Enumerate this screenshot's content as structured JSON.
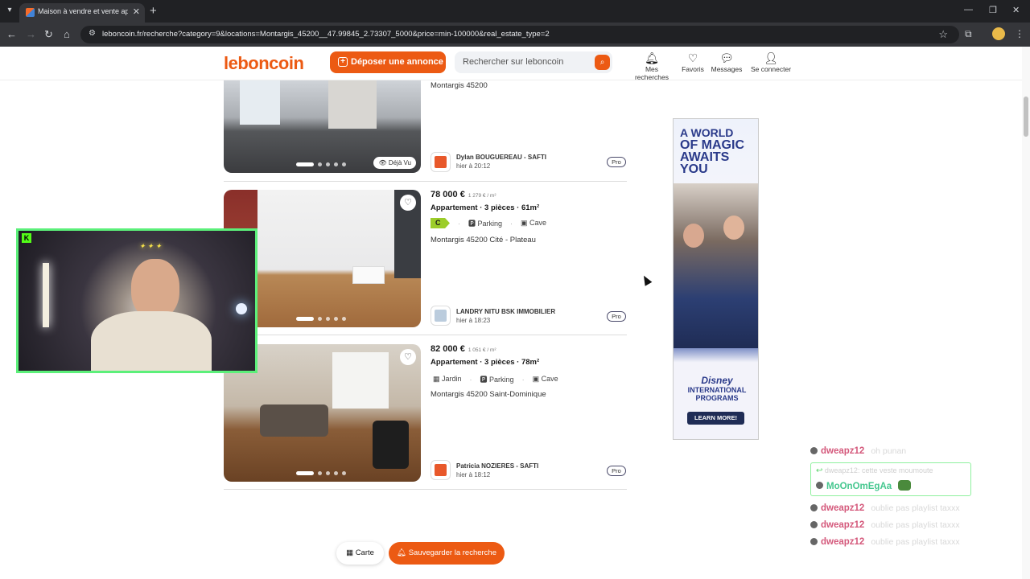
{
  "browser": {
    "tab_title": "Maison à vendre et vente appa",
    "url": "leboncoin.fr/recherche?category=9&locations=Montargis_45200__47.99845_2.73307_5000&price=min-100000&real_estate_type=2"
  },
  "header": {
    "logo": "leboncoin",
    "post_ad": "Déposer une annonce",
    "search_placeholder": "Rechercher sur leboncoin",
    "nav": [
      {
        "label": "Mes recherches",
        "icon": "bell-icon"
      },
      {
        "label": "Favoris",
        "icon": "heart-icon"
      },
      {
        "label": "Messages",
        "icon": "chat-icon"
      },
      {
        "label": "Se connecter",
        "icon": "user-icon"
      }
    ]
  },
  "listings": [
    {
      "location": "Montargis 45200",
      "seen_badge": "Déjà Vu",
      "seller": "Dylan BOUGUEREAU - SAFTI",
      "date": "hier à 20:12",
      "pro": "Pro"
    },
    {
      "price": "78 000 €",
      "price_per_m2": "1 279 € / m²",
      "title": "Appartement · 3 pièces · 61m²",
      "energy": "C",
      "tags": [
        "Parking",
        "Cave"
      ],
      "location": "Montargis 45200 Cité - Plateau",
      "seller": "LANDRY NITU BSK IMMOBILIER",
      "date": "hier à 18:23",
      "pro": "Pro"
    },
    {
      "price": "82 000 €",
      "price_per_m2": "1 051 € / m²",
      "title": "Appartement · 3 pièces · 78m²",
      "tags": [
        "Jardin",
        "Parking",
        "Cave"
      ],
      "location": "Montargis 45200 Saint-Dominique",
      "seller": "Patricia NOZIERES - SAFTI",
      "date": "hier à 18:12",
      "pro": "Pro"
    }
  ],
  "ad": {
    "line1": "A WORLD",
    "line2": "OF MAGIC",
    "line3": "AWAITS YOU",
    "brand": "Disney",
    "programs": "INTERNATIONAL PROGRAMS",
    "cta": "LEARN MORE!"
  },
  "chat": [
    {
      "user": "dweapz12",
      "msg": "oh punan"
    },
    {
      "reply_to": "dweapz12: cette veste moumoute",
      "user": "MoOnOmEgAa"
    },
    {
      "user": "dweapz12",
      "msg": "oublie pas playlist taxxx"
    },
    {
      "user": "dweapz12",
      "msg": "oublie pas playlist taxxx"
    },
    {
      "user": "dweapz12",
      "msg": "oublie pas playlist taxxx"
    }
  ],
  "bottom": {
    "map": "Carte",
    "save_search": "Sauvegarder la recherche"
  }
}
